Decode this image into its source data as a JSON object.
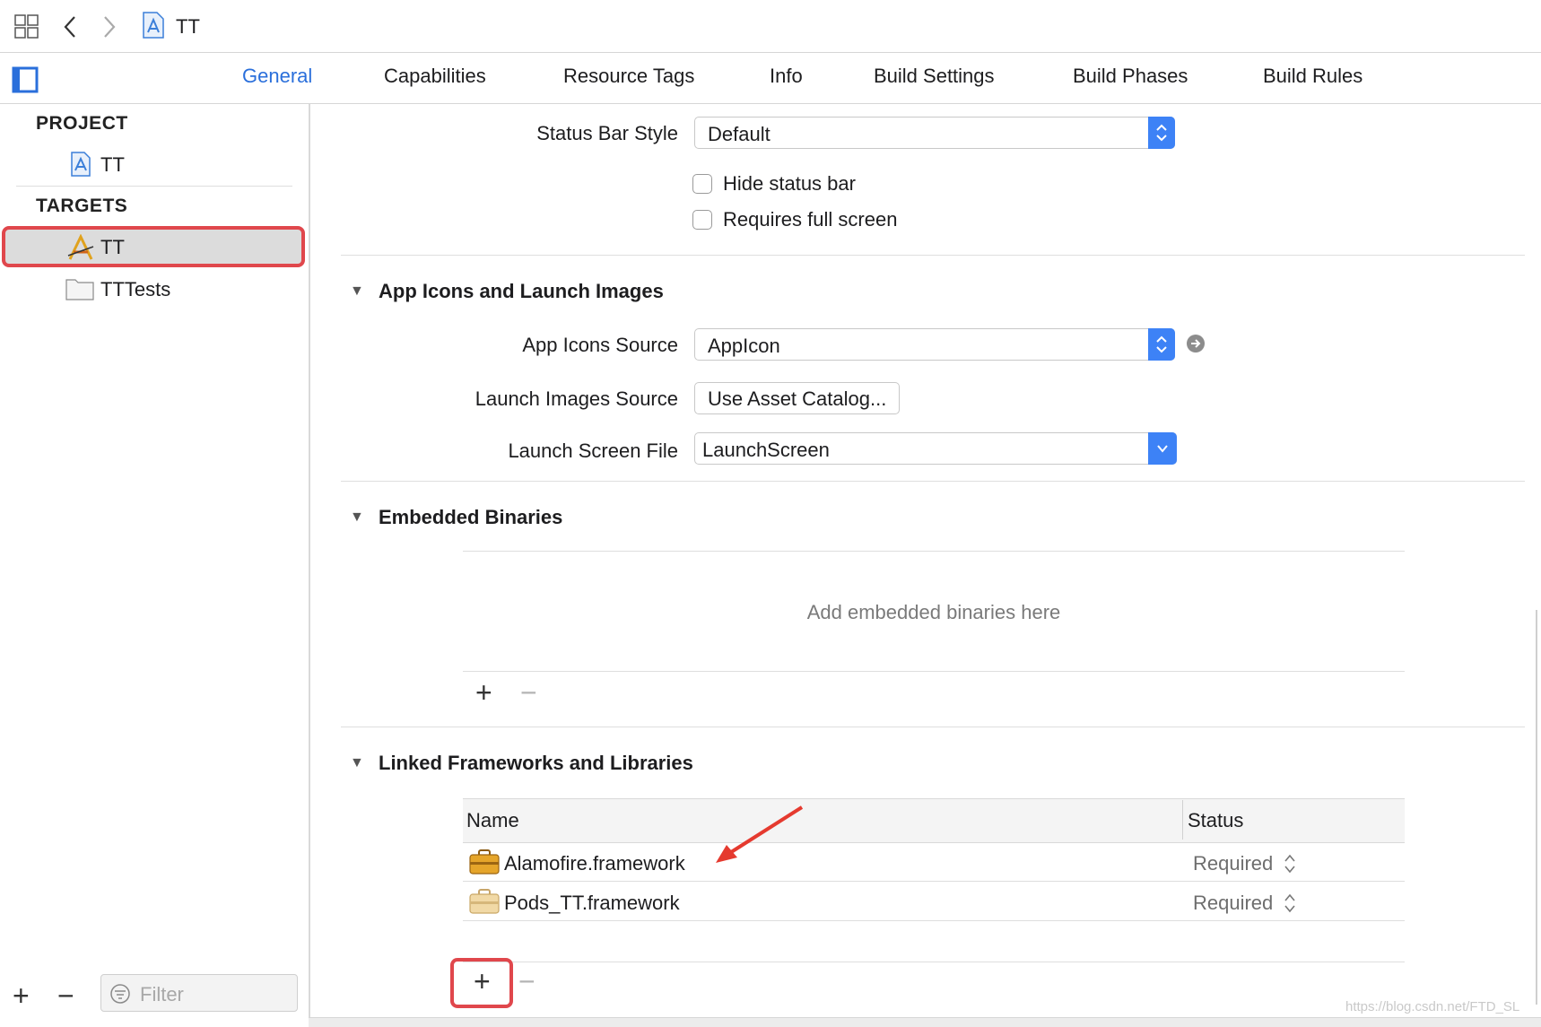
{
  "window": {
    "title": "TT"
  },
  "tabs": [
    {
      "label": "General",
      "active": true
    },
    {
      "label": "Capabilities"
    },
    {
      "label": "Resource Tags"
    },
    {
      "label": "Info"
    },
    {
      "label": "Build Settings"
    },
    {
      "label": "Build Phases"
    },
    {
      "label": "Build Rules"
    }
  ],
  "sidebar": {
    "project_heading": "PROJECT",
    "project_item": "TT",
    "targets_heading": "TARGETS",
    "targets": [
      {
        "label": "TT",
        "selected": true
      },
      {
        "label": "TTTests"
      }
    ],
    "filter_placeholder": "Filter"
  },
  "status_bar": {
    "style_label": "Status Bar Style",
    "style_value": "Default",
    "hide_label": "Hide status bar",
    "fullscreen_label": "Requires full screen"
  },
  "app_icons": {
    "section_title": "App Icons and Launch Images",
    "icons_source_label": "App Icons Source",
    "icons_source_value": "AppIcon",
    "launch_images_label": "Launch Images Source",
    "launch_images_button": "Use Asset Catalog...",
    "launch_screen_label": "Launch Screen File",
    "launch_screen_value": "LaunchScreen"
  },
  "embedded": {
    "section_title": "Embedded Binaries",
    "placeholder": "Add embedded binaries here"
  },
  "linked": {
    "section_title": "Linked Frameworks and Libraries",
    "columns": {
      "name": "Name",
      "status": "Status"
    },
    "rows": [
      {
        "name": "Alamofire.framework",
        "status": "Required"
      },
      {
        "name": "Pods_TT.framework",
        "status": "Required"
      }
    ]
  },
  "watermark": "https://blog.csdn.net/FTD_SL",
  "colors": {
    "accent": "#2a6fdb",
    "highlight": "#e0474c",
    "arrow": "#e53a2f"
  }
}
